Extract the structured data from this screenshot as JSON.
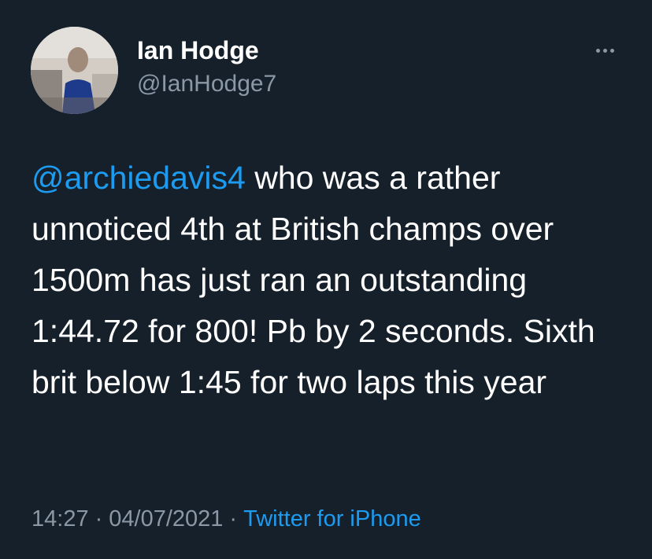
{
  "author": {
    "display_name": "Ian Hodge",
    "handle": "@IanHodge7",
    "avatar_icon": "profile-photo-avatar"
  },
  "menu": {
    "icon": "more-options-icon"
  },
  "tweet": {
    "mention": "@archiedavis4",
    "text": " who was a rather unnoticed 4th at British champs over 1500m has just ran an outstanding 1:44.72 for 800! Pb by 2 seconds. Sixth brit below 1:45 for two laps this year"
  },
  "meta": {
    "time": "14:27",
    "separator": "·",
    "date": "04/07/2021",
    "source": "Twitter for iPhone"
  },
  "colors": {
    "background": "#15202b",
    "primary_text": "#ffffff",
    "secondary_text": "#8b98a5",
    "link": "#1d9bf0"
  }
}
